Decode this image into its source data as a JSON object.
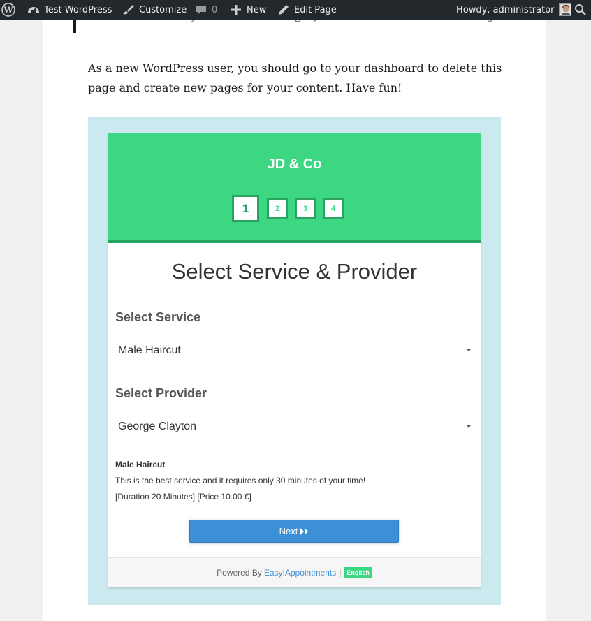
{
  "adminbar": {
    "site_name": "Test WordPress",
    "customize": "Customize",
    "comments_count": "0",
    "new": "New",
    "edit_page": "Edit Page",
    "howdy": "Howdy, administrator"
  },
  "article": {
    "quote_text": "does all kinds of awesome things for the Gotham community.",
    "intro_before": "As a new WordPress user, you should go to ",
    "intro_link": "your dashboard",
    "intro_after": " to delete this page and create new pages for your content. Have fun!"
  },
  "booking": {
    "company": "JD & Co",
    "steps": [
      "1",
      "2",
      "3",
      "4"
    ],
    "active_step": 1,
    "section_title": "Select Service & Provider",
    "service_label": "Select Service",
    "service_value": "Male Haircut",
    "provider_label": "Select Provider",
    "provider_value": "George Clayton",
    "details": {
      "title": "Male Haircut",
      "description": "This is the best service and it requires only 30 minutes of your time!",
      "meta": "[Duration 20 Minutes] [Price 10.00 €]"
    },
    "next_label": "Next",
    "footer": {
      "powered_by": "Powered By",
      "link": "Easy!Appointments",
      "separator": "|",
      "language": "English"
    }
  },
  "colors": {
    "header_green": "#3dd682",
    "button_blue": "#3d8fd6",
    "frame_blue": "#cbeaf0",
    "adminbar_bg": "#23282d"
  }
}
